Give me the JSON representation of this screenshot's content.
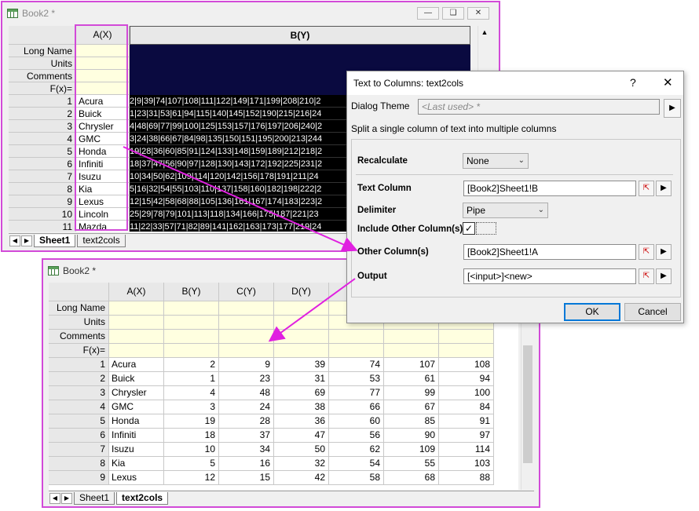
{
  "top_window": {
    "title": "Book2 *",
    "col_a": "A(X)",
    "col_b": "B(Y)",
    "row_labels": [
      "Long Name",
      "Units",
      "Comments",
      "F(x)="
    ],
    "rows": [
      {
        "n": "1",
        "a": "Acura",
        "b": "2|9|39|74|107|108|111|122|149|171|199|208|210|2"
      },
      {
        "n": "2",
        "a": "Buick",
        "b": "1|23|31|53|61|94|115|140|145|152|190|215|216|24"
      },
      {
        "n": "3",
        "a": "Chrysler",
        "b": "4|48|69|77|99|100|125|153|157|176|197|206|240|2"
      },
      {
        "n": "4",
        "a": "GMC",
        "b": "3|24|38|66|67|84|98|135|150|151|195|200|213|244"
      },
      {
        "n": "5",
        "a": "Honda",
        "b": "19|28|36|60|85|91|124|133|148|159|189|212|218|2"
      },
      {
        "n": "6",
        "a": "Infiniti",
        "b": "18|37|47|56|90|97|128|130|143|172|192|225|231|2"
      },
      {
        "n": "7",
        "a": "Isuzu",
        "b": "10|34|50|62|109|114|120|142|156|178|191|211|24"
      },
      {
        "n": "8",
        "a": "Kia",
        "b": "5|16|32|54|55|103|110|137|158|160|182|198|222|2"
      },
      {
        "n": "9",
        "a": "Lexus",
        "b": "12|15|42|58|68|88|105|136|161|167|174|183|223|2"
      },
      {
        "n": "10",
        "a": "Lincoln",
        "b": "25|29|78|79|101|113|118|134|166|175|187|221|23"
      },
      {
        "n": "11",
        "a": "Mazda",
        "b": "11|22|33|57|71|82|89|141|162|163|173|177|219|24"
      }
    ],
    "tabs": [
      "Sheet1",
      "text2cols"
    ]
  },
  "dialog": {
    "title": "Text to Columns: text2cols",
    "help": "?",
    "close": "✕",
    "theme_label": "Dialog Theme",
    "theme_value": "<Last used> *",
    "description": "Split a single column of text into multiple columns",
    "recalculate_label": "Recalculate",
    "recalculate_value": "None",
    "text_column_label": "Text Column",
    "text_column_value": "[Book2]Sheet1!B",
    "delimiter_label": "Delimiter",
    "delimiter_value": "Pipe",
    "include_other_label": "Include Other Column(s)",
    "include_other_checked": "✓",
    "other_columns_label": "Other Column(s)",
    "other_columns_value": "[Book2]Sheet1!A",
    "output_label": "Output",
    "output_value": "[<input>]<new>",
    "ok": "OK",
    "cancel": "Cancel"
  },
  "bottom_window": {
    "title": "Book2 *",
    "columns": [
      "A(X)",
      "B(Y)",
      "C(Y)",
      "D(Y)"
    ],
    "row_labels": [
      "Long Name",
      "Units",
      "Comments",
      "F(x)="
    ],
    "rows": [
      {
        "n": "1",
        "a": "Acura",
        "v": [
          "2",
          "9",
          "39",
          "74",
          "107",
          "108"
        ]
      },
      {
        "n": "2",
        "a": "Buick",
        "v": [
          "1",
          "23",
          "31",
          "53",
          "61",
          "94"
        ]
      },
      {
        "n": "3",
        "a": "Chrysler",
        "v": [
          "4",
          "48",
          "69",
          "77",
          "99",
          "100"
        ]
      },
      {
        "n": "4",
        "a": "GMC",
        "v": [
          "3",
          "24",
          "38",
          "66",
          "67",
          "84"
        ]
      },
      {
        "n": "5",
        "a": "Honda",
        "v": [
          "19",
          "28",
          "36",
          "60",
          "85",
          "91"
        ]
      },
      {
        "n": "6",
        "a": "Infiniti",
        "v": [
          "18",
          "37",
          "47",
          "56",
          "90",
          "97"
        ]
      },
      {
        "n": "7",
        "a": "Isuzu",
        "v": [
          "10",
          "34",
          "50",
          "62",
          "109",
          "114"
        ]
      },
      {
        "n": "8",
        "a": "Kia",
        "v": [
          "5",
          "16",
          "32",
          "54",
          "55",
          "103"
        ]
      },
      {
        "n": "9",
        "a": "Lexus",
        "v": [
          "12",
          "15",
          "42",
          "58",
          "68",
          "88"
        ]
      }
    ],
    "tabs": [
      "Sheet1",
      "text2cols"
    ]
  },
  "colors": {
    "highlight": "#d24ad8",
    "navy": "#0a0a40",
    "yellow": "#ffffe0",
    "ok_border": "#0078d7"
  }
}
